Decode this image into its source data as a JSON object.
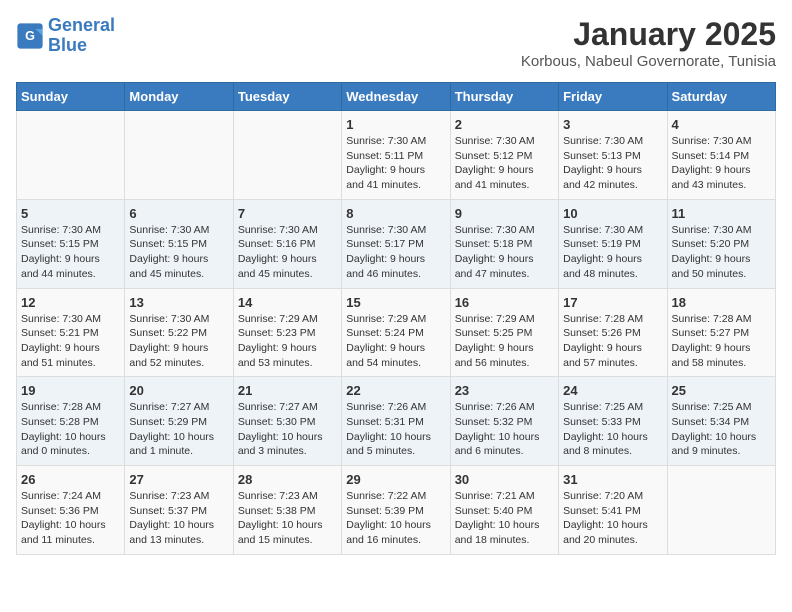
{
  "header": {
    "logo_line1": "General",
    "logo_line2": "Blue",
    "title": "January 2025",
    "subtitle": "Korbous, Nabeul Governorate, Tunisia"
  },
  "weekdays": [
    "Sunday",
    "Monday",
    "Tuesday",
    "Wednesday",
    "Thursday",
    "Friday",
    "Saturday"
  ],
  "weeks": [
    [
      {
        "day": "",
        "info": ""
      },
      {
        "day": "",
        "info": ""
      },
      {
        "day": "",
        "info": ""
      },
      {
        "day": "1",
        "info": "Sunrise: 7:30 AM\nSunset: 5:11 PM\nDaylight: 9 hours\nand 41 minutes."
      },
      {
        "day": "2",
        "info": "Sunrise: 7:30 AM\nSunset: 5:12 PM\nDaylight: 9 hours\nand 41 minutes."
      },
      {
        "day": "3",
        "info": "Sunrise: 7:30 AM\nSunset: 5:13 PM\nDaylight: 9 hours\nand 42 minutes."
      },
      {
        "day": "4",
        "info": "Sunrise: 7:30 AM\nSunset: 5:14 PM\nDaylight: 9 hours\nand 43 minutes."
      }
    ],
    [
      {
        "day": "5",
        "info": "Sunrise: 7:30 AM\nSunset: 5:15 PM\nDaylight: 9 hours\nand 44 minutes."
      },
      {
        "day": "6",
        "info": "Sunrise: 7:30 AM\nSunset: 5:15 PM\nDaylight: 9 hours\nand 45 minutes."
      },
      {
        "day": "7",
        "info": "Sunrise: 7:30 AM\nSunset: 5:16 PM\nDaylight: 9 hours\nand 45 minutes."
      },
      {
        "day": "8",
        "info": "Sunrise: 7:30 AM\nSunset: 5:17 PM\nDaylight: 9 hours\nand 46 minutes."
      },
      {
        "day": "9",
        "info": "Sunrise: 7:30 AM\nSunset: 5:18 PM\nDaylight: 9 hours\nand 47 minutes."
      },
      {
        "day": "10",
        "info": "Sunrise: 7:30 AM\nSunset: 5:19 PM\nDaylight: 9 hours\nand 48 minutes."
      },
      {
        "day": "11",
        "info": "Sunrise: 7:30 AM\nSunset: 5:20 PM\nDaylight: 9 hours\nand 50 minutes."
      }
    ],
    [
      {
        "day": "12",
        "info": "Sunrise: 7:30 AM\nSunset: 5:21 PM\nDaylight: 9 hours\nand 51 minutes."
      },
      {
        "day": "13",
        "info": "Sunrise: 7:30 AM\nSunset: 5:22 PM\nDaylight: 9 hours\nand 52 minutes."
      },
      {
        "day": "14",
        "info": "Sunrise: 7:29 AM\nSunset: 5:23 PM\nDaylight: 9 hours\nand 53 minutes."
      },
      {
        "day": "15",
        "info": "Sunrise: 7:29 AM\nSunset: 5:24 PM\nDaylight: 9 hours\nand 54 minutes."
      },
      {
        "day": "16",
        "info": "Sunrise: 7:29 AM\nSunset: 5:25 PM\nDaylight: 9 hours\nand 56 minutes."
      },
      {
        "day": "17",
        "info": "Sunrise: 7:28 AM\nSunset: 5:26 PM\nDaylight: 9 hours\nand 57 minutes."
      },
      {
        "day": "18",
        "info": "Sunrise: 7:28 AM\nSunset: 5:27 PM\nDaylight: 9 hours\nand 58 minutes."
      }
    ],
    [
      {
        "day": "19",
        "info": "Sunrise: 7:28 AM\nSunset: 5:28 PM\nDaylight: 10 hours\nand 0 minutes."
      },
      {
        "day": "20",
        "info": "Sunrise: 7:27 AM\nSunset: 5:29 PM\nDaylight: 10 hours\nand 1 minute."
      },
      {
        "day": "21",
        "info": "Sunrise: 7:27 AM\nSunset: 5:30 PM\nDaylight: 10 hours\nand 3 minutes."
      },
      {
        "day": "22",
        "info": "Sunrise: 7:26 AM\nSunset: 5:31 PM\nDaylight: 10 hours\nand 5 minutes."
      },
      {
        "day": "23",
        "info": "Sunrise: 7:26 AM\nSunset: 5:32 PM\nDaylight: 10 hours\nand 6 minutes."
      },
      {
        "day": "24",
        "info": "Sunrise: 7:25 AM\nSunset: 5:33 PM\nDaylight: 10 hours\nand 8 minutes."
      },
      {
        "day": "25",
        "info": "Sunrise: 7:25 AM\nSunset: 5:34 PM\nDaylight: 10 hours\nand 9 minutes."
      }
    ],
    [
      {
        "day": "26",
        "info": "Sunrise: 7:24 AM\nSunset: 5:36 PM\nDaylight: 10 hours\nand 11 minutes."
      },
      {
        "day": "27",
        "info": "Sunrise: 7:23 AM\nSunset: 5:37 PM\nDaylight: 10 hours\nand 13 minutes."
      },
      {
        "day": "28",
        "info": "Sunrise: 7:23 AM\nSunset: 5:38 PM\nDaylight: 10 hours\nand 15 minutes."
      },
      {
        "day": "29",
        "info": "Sunrise: 7:22 AM\nSunset: 5:39 PM\nDaylight: 10 hours\nand 16 minutes."
      },
      {
        "day": "30",
        "info": "Sunrise: 7:21 AM\nSunset: 5:40 PM\nDaylight: 10 hours\nand 18 minutes."
      },
      {
        "day": "31",
        "info": "Sunrise: 7:20 AM\nSunset: 5:41 PM\nDaylight: 10 hours\nand 20 minutes."
      },
      {
        "day": "",
        "info": ""
      }
    ]
  ]
}
